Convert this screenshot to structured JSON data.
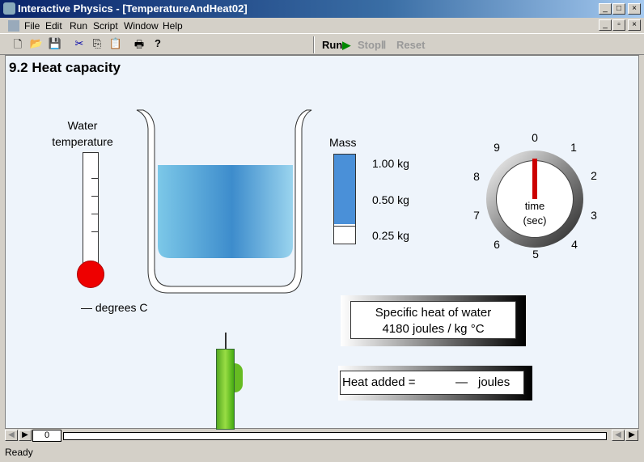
{
  "window": {
    "title": "Interactive Physics - [TemperatureAndHeat02]"
  },
  "menu": [
    "File",
    "Edit",
    "Run",
    "Script",
    "Window",
    "Help"
  ],
  "controls": {
    "run": "Run",
    "stop": "Stop",
    "reset": "Reset"
  },
  "page": {
    "title": "9.2 Heat capacity"
  },
  "thermometer": {
    "label_line1": "Water",
    "label_line2": "temperature",
    "reading": "— degrees C"
  },
  "mass": {
    "label": "Mass",
    "options": [
      "1.00 kg",
      "0.50 kg",
      "0.25 kg"
    ]
  },
  "clock": {
    "numbers": [
      "0",
      "1",
      "2",
      "3",
      "4",
      "5",
      "6",
      "7",
      "8",
      "9"
    ],
    "label_line1": "time",
    "label_line2": "(sec)"
  },
  "specific_heat": {
    "line1": "Specific heat of water",
    "line2": "4180 joules / kg °C"
  },
  "heat_added": {
    "label": "Heat added =",
    "value": "—",
    "unit": "joules"
  },
  "timeline": {
    "frame": "0"
  },
  "status": "Ready"
}
